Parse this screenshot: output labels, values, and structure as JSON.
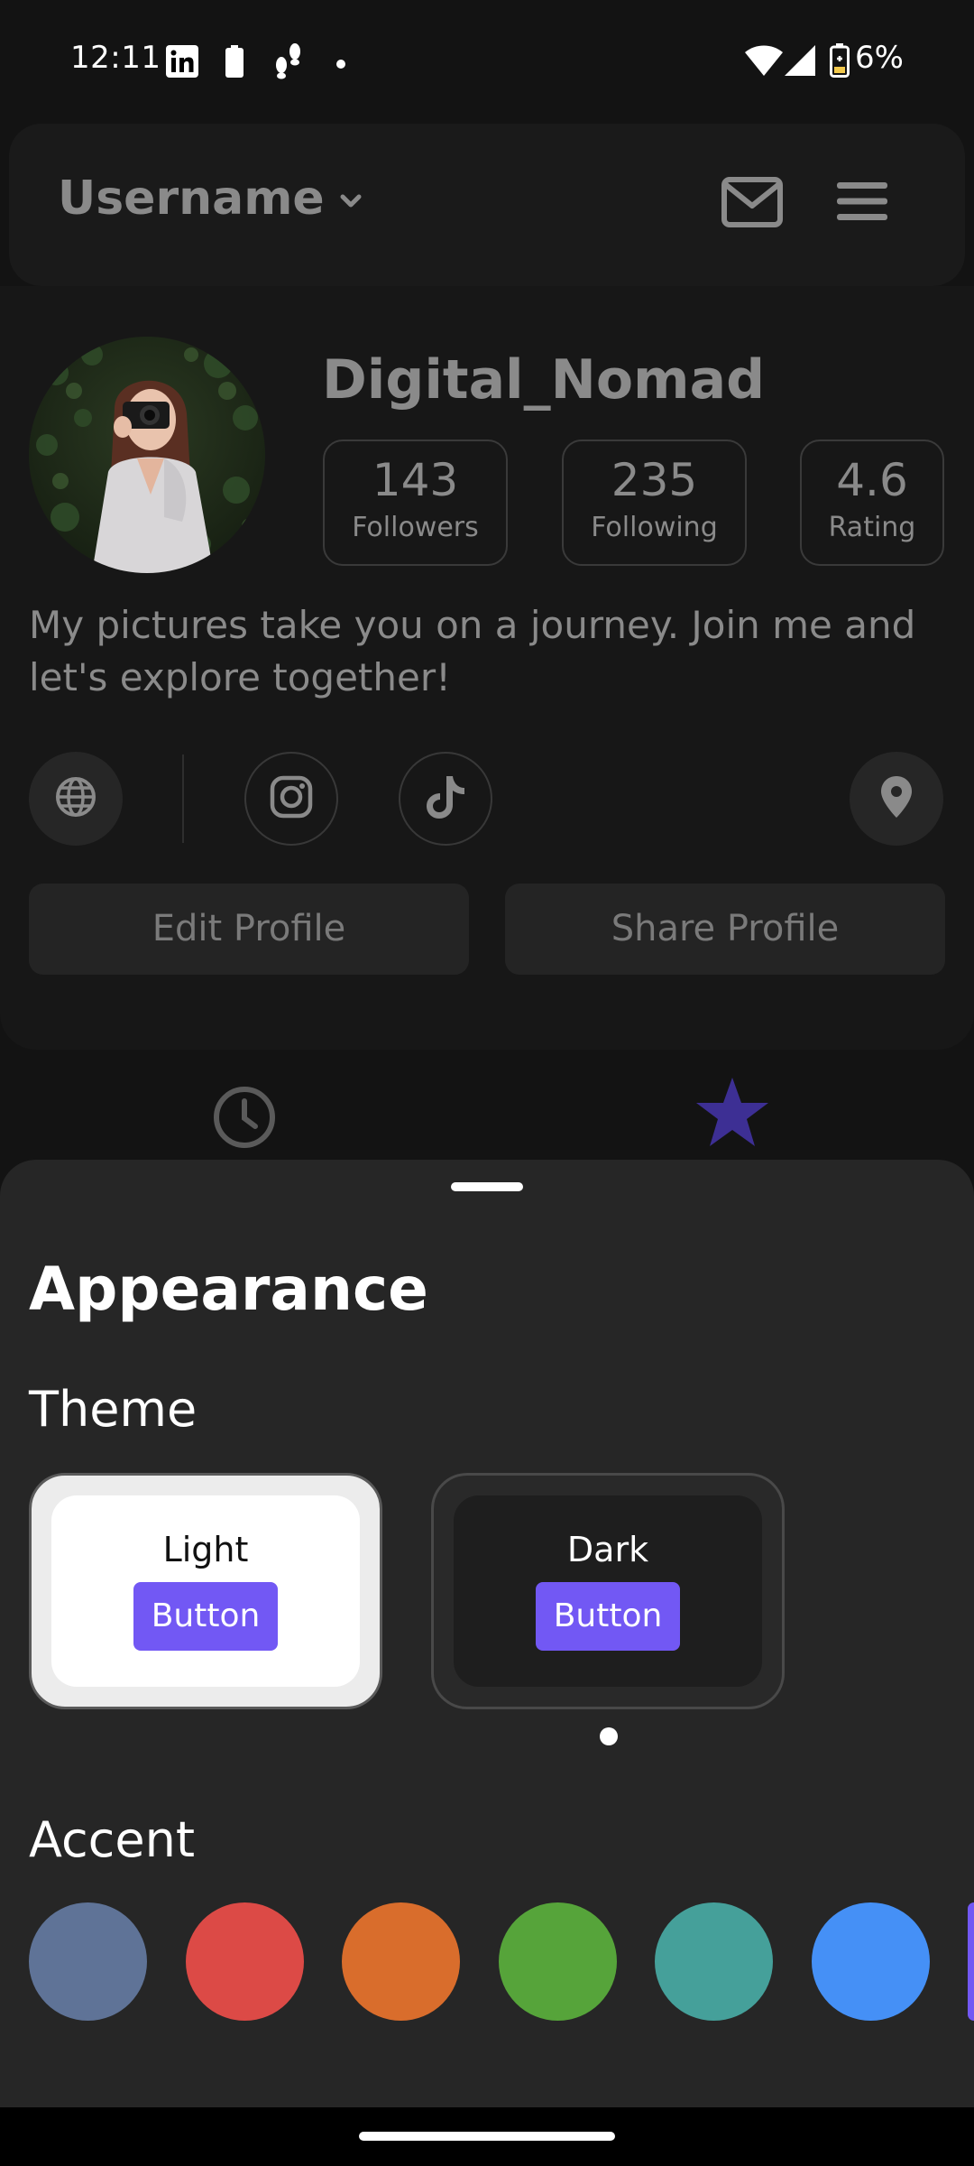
{
  "status_bar": {
    "time": "12:11",
    "battery_percent": "6%"
  },
  "header": {
    "username": "Username"
  },
  "profile": {
    "name": "Digital_Nomad",
    "stats": [
      {
        "value": "143",
        "label": "Followers"
      },
      {
        "value": "235",
        "label": "Following"
      },
      {
        "value": "4.6",
        "label": "Rating"
      }
    ],
    "bio": "My pictures take you on a journey. Join me and let's explore together!",
    "edit_button": "Edit Profile",
    "share_button": "Share Profile"
  },
  "social_icons": [
    "globe-icon",
    "instagram-icon",
    "tiktok-icon",
    "location-pin-icon"
  ],
  "tabs": {
    "icons": [
      "clock-icon",
      "star-icon"
    ],
    "active_color": "#3d2f94"
  },
  "sheet": {
    "title": "Appearance",
    "theme_label": "Theme",
    "themes": [
      {
        "name": "Light",
        "button": "Button"
      },
      {
        "name": "Dark",
        "button": "Button"
      }
    ],
    "accent_label": "Accent",
    "accent_colors": [
      "#5f7397",
      "#dc4a46",
      "#d96d2c",
      "#56a43a",
      "#45a09a",
      "#4590f6",
      "#7258f4"
    ],
    "sample_button_color": "#7258f4"
  }
}
